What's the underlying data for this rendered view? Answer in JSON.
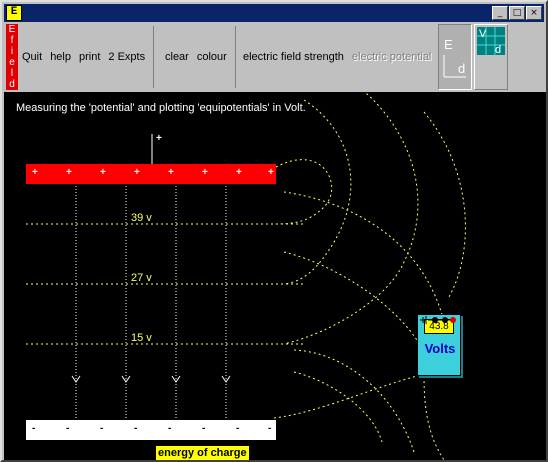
{
  "app": {
    "icon_glyph": "E"
  },
  "window_controls": {
    "minimize": "_",
    "maximize": "□",
    "close": "×"
  },
  "logo": {
    "letters": [
      "E",
      "f",
      "i",
      "e",
      "l",
      "d"
    ]
  },
  "menu": {
    "quit": "Quit",
    "help": "help",
    "print": "print",
    "expts": "2 Expts",
    "clear": "clear",
    "colour": "colour",
    "field_strength": "electric field strength",
    "potential": "electric potential"
  },
  "mode_buttons": {
    "field": {
      "letters": [
        "E",
        "d"
      ],
      "icon": "field-mode-icon",
      "selected": true
    },
    "potential": {
      "letters": [
        "V",
        "d"
      ],
      "icon": "potential-grid-icon",
      "selected": false
    }
  },
  "canvas": {
    "heading": "Measuring the 'potential' and plotting 'equipotentials' in Volt.",
    "top_plate_charge": "+",
    "bottom_plate_charge": "-",
    "probe_charge": "+",
    "equipotentials": [
      {
        "label": "39 v"
      },
      {
        "label": "27 v"
      },
      {
        "label": "15 v"
      }
    ],
    "energy_label": "energy of charge"
  },
  "voltmeter": {
    "reading": "43.8",
    "label": "Volts"
  },
  "colors": {
    "canvas_bg": "#000000",
    "top_plate": "#ff0000",
    "bottom_plate": "#ffffff",
    "equipotential_line": "#ffff66",
    "voltmeter_body": "#3ccfdc",
    "voltmeter_display": "#ffff00",
    "title_bar": "#0a246a",
    "logo_bg": "#e00000"
  }
}
